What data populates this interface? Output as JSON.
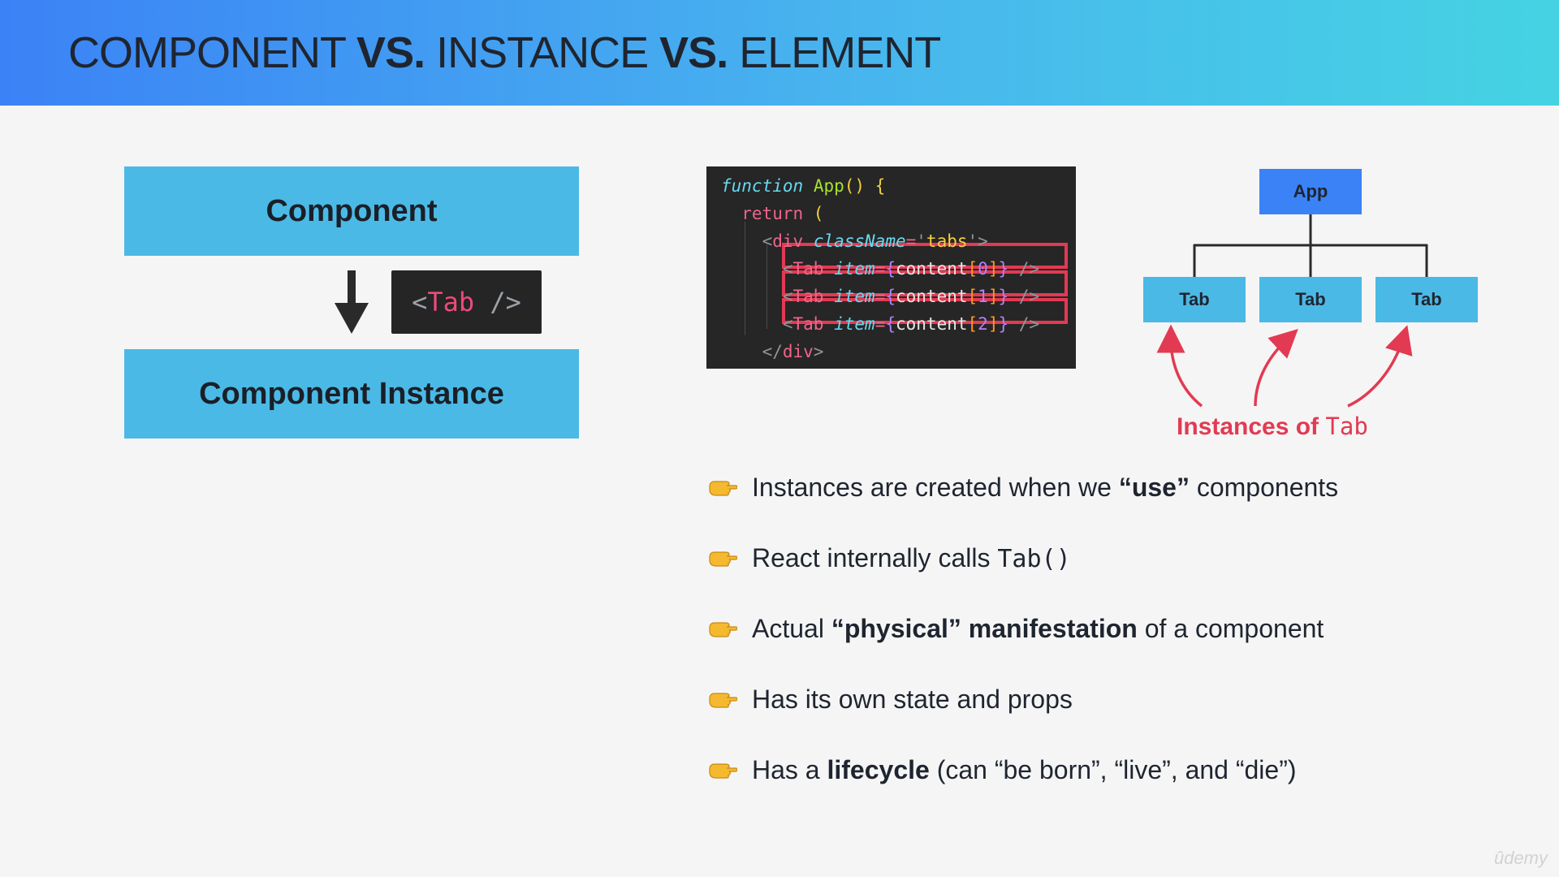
{
  "header": {
    "title_parts": [
      "COMPONENT",
      "VS.",
      "INSTANCE",
      "VS.",
      "ELEMENT"
    ]
  },
  "left": {
    "component_label": "Component",
    "instance_label": "Component Instance",
    "tab_chip": {
      "open": "<",
      "name": "Tab",
      "close": " />"
    }
  },
  "code": {
    "lines": [
      [
        [
          "function",
          "it"
        ],
        [
          " ",
          "wh"
        ],
        [
          "App",
          "fn"
        ],
        [
          "() {",
          "yl"
        ]
      ],
      [
        [
          "  return",
          "pk"
        ],
        [
          " (",
          "yl"
        ]
      ],
      [
        [
          "    <",
          "gy"
        ],
        [
          "div",
          "pk"
        ],
        [
          " ",
          "wh"
        ],
        [
          "className",
          "it"
        ],
        [
          "=",
          "pk"
        ],
        [
          "'",
          "gy"
        ],
        [
          "tabs",
          "yl"
        ],
        [
          "'",
          "gy"
        ],
        [
          ">",
          "gy"
        ]
      ],
      [
        [
          "      <",
          "gy"
        ],
        [
          "Tab",
          "pk"
        ],
        [
          " ",
          "wh"
        ],
        [
          "item",
          "it"
        ],
        [
          "=",
          "pk"
        ],
        [
          "{",
          "bl"
        ],
        [
          "content",
          "wh"
        ],
        [
          "[",
          "or"
        ],
        [
          "0",
          "bl"
        ],
        [
          "]",
          "or"
        ],
        [
          "}",
          "bl"
        ],
        [
          " />",
          "gy"
        ]
      ],
      [
        [
          "      <",
          "gy"
        ],
        [
          "Tab",
          "pk"
        ],
        [
          " ",
          "wh"
        ],
        [
          "item",
          "it"
        ],
        [
          "=",
          "pk"
        ],
        [
          "{",
          "bl"
        ],
        [
          "content",
          "wh"
        ],
        [
          "[",
          "or"
        ],
        [
          "1",
          "bl"
        ],
        [
          "]",
          "or"
        ],
        [
          "}",
          "bl"
        ],
        [
          " />",
          "gy"
        ]
      ],
      [
        [
          "      <",
          "gy"
        ],
        [
          "Tab",
          "pk"
        ],
        [
          " ",
          "wh"
        ],
        [
          "item",
          "it"
        ],
        [
          "=",
          "pk"
        ],
        [
          "{",
          "bl"
        ],
        [
          "content",
          "wh"
        ],
        [
          "[",
          "or"
        ],
        [
          "2",
          "bl"
        ],
        [
          "]",
          "or"
        ],
        [
          "}",
          "bl"
        ],
        [
          " />",
          "gy"
        ]
      ],
      [
        [
          "    </",
          "gy"
        ],
        [
          "div",
          "pk"
        ],
        [
          ">",
          "gy"
        ]
      ]
    ],
    "highlight_color": "#e23a52"
  },
  "tree": {
    "root": "App",
    "children": [
      "Tab",
      "Tab",
      "Tab"
    ],
    "annotation_prefix": "Instances of",
    "annotation_code": "Tab"
  },
  "bullets": [
    {
      "parts": [
        [
          "Instances are created when we ",
          "n"
        ],
        [
          "“use”",
          "b"
        ],
        [
          " components",
          "n"
        ]
      ]
    },
    {
      "parts": [
        [
          "React internally calls ",
          "n"
        ],
        [
          "Tab()",
          "m"
        ]
      ]
    },
    {
      "parts": [
        [
          "Actual ",
          "n"
        ],
        [
          "“physical” manifestation",
          "b"
        ],
        [
          " of a component",
          "n"
        ]
      ]
    },
    {
      "parts": [
        [
          "Has its own state and props",
          "n"
        ]
      ]
    },
    {
      "parts": [
        [
          "Has a ",
          "n"
        ],
        [
          "lifecycle",
          "b"
        ],
        [
          " (can “be born”, “live”, and “die”)",
          "n"
        ]
      ]
    }
  ],
  "watermark": "ûdemy",
  "colors": {
    "accent_blue": "#3b82f6",
    "box_blue": "#4bb9e6",
    "highlight_red": "#e23a52",
    "hand_yellow": "#f5b930"
  },
  "icons": {
    "bullet": "pointing-hand-icon",
    "arrow": "down-arrow-icon"
  }
}
